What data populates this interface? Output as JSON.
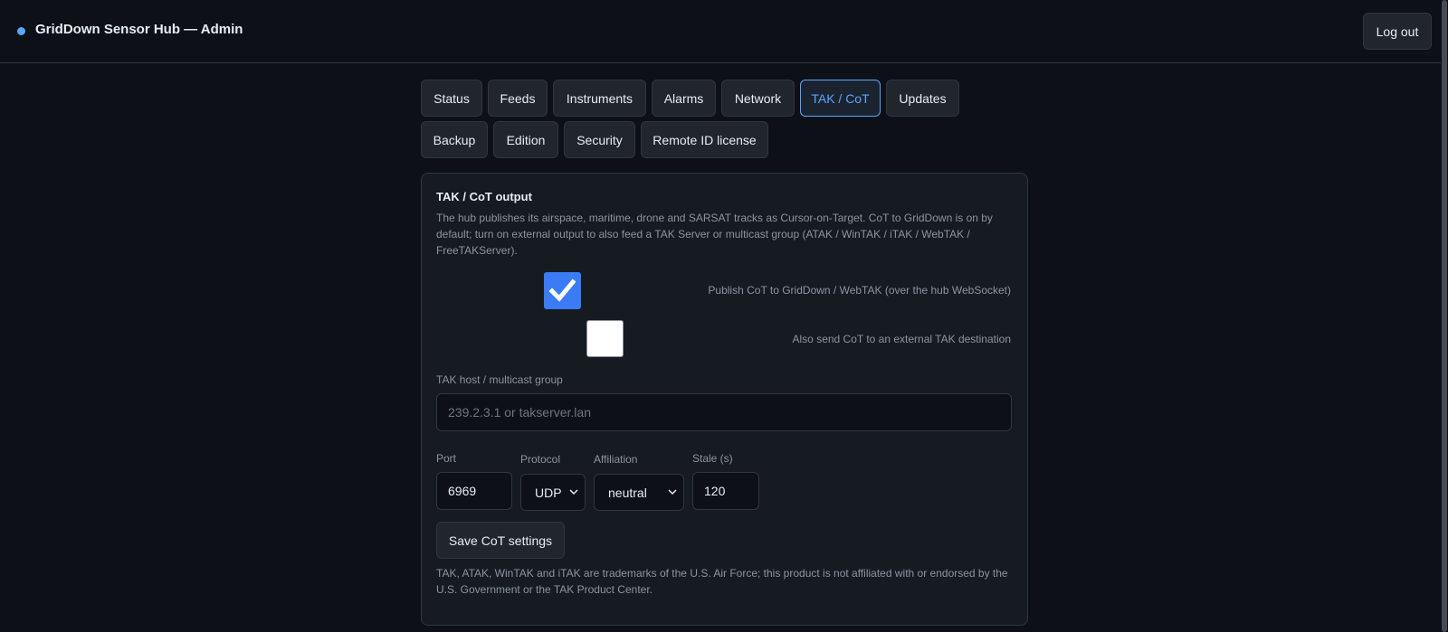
{
  "header": {
    "title": "GridDown Sensor Hub — Admin",
    "logout_label": "Log out",
    "accent_color": "#58a6ff"
  },
  "tabs": [
    {
      "label": "Status"
    },
    {
      "label": "Feeds"
    },
    {
      "label": "Instruments"
    },
    {
      "label": "Alarms"
    },
    {
      "label": "Network"
    },
    {
      "label": "TAK / CoT",
      "active": true
    },
    {
      "label": "Updates"
    },
    {
      "label": "Backup"
    },
    {
      "label": "Edition"
    },
    {
      "label": "Security"
    },
    {
      "label": "Remote ID license"
    }
  ],
  "panel": {
    "title": "TAK / CoT output",
    "description": "The hub publishes its airspace, maritime, drone and SARSAT tracks as Cursor-on-Target. CoT to GridDown is on by default; turn on external output to also feed a TAK Server or multicast group (ATAK / WinTAK / iTAK / WebTAK / FreeTAKServer).",
    "publish_gridown": {
      "label": "Publish CoT to GridDown / WebTAK (over the hub WebSocket)",
      "checked": true
    },
    "external_tak": {
      "label": "Also send CoT to an external TAK destination",
      "checked": false
    },
    "host": {
      "label": "TAK host / multicast group",
      "value": "",
      "placeholder": "239.2.3.1 or takserver.lan"
    },
    "port": {
      "label": "Port",
      "value": "6969"
    },
    "protocol": {
      "label": "Protocol",
      "value": "UDP"
    },
    "affiliation": {
      "label": "Affiliation",
      "value": "neutral"
    },
    "stale": {
      "label": "Stale (s)",
      "value": "120"
    },
    "save_label": "Save CoT settings",
    "disclaimer": "TAK, ATAK, WinTAK and iTAK are trademarks of the U.S. Air Force; this product is not affiliated with or endorsed by the U.S. Government or the TAK Product Center."
  }
}
